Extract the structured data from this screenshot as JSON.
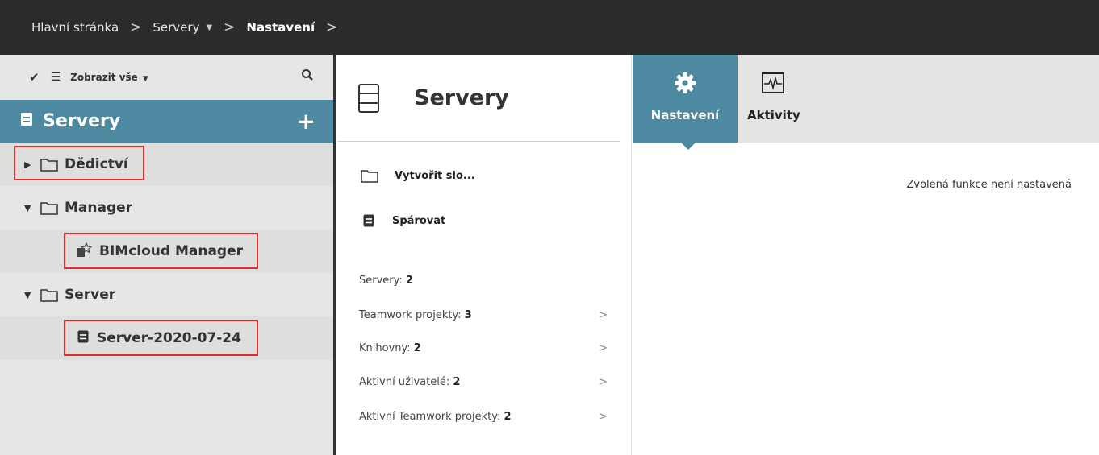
{
  "breadcrumb": {
    "items": [
      "Hlavní stránka",
      "Servery",
      "Nastavení"
    ]
  },
  "left": {
    "toolbar": {
      "filter_label": "Zobrazit vše"
    },
    "header": {
      "title": "Servery"
    },
    "tree": {
      "dedictvi": "Dědictví",
      "manager": "Manager",
      "bimcloud_manager": "BIMcloud Manager",
      "server": "Server",
      "server_item": "Server-2020-07-24"
    }
  },
  "middle": {
    "title": "Servery",
    "actions": [
      "Vytvořit slo...",
      "Spárovat"
    ],
    "stats": [
      {
        "label": "Servery: ",
        "value": "2"
      },
      {
        "label": "Teamwork projekty: ",
        "value": "3"
      },
      {
        "label": "Knihovny: ",
        "value": "2"
      },
      {
        "label": "Aktivní uživatelé: ",
        "value": "2"
      },
      {
        "label": "Aktivní Teamwork projekty: ",
        "value": "2"
      }
    ]
  },
  "right": {
    "tabs": [
      {
        "label": "Nastavení",
        "icon": "gear-icon"
      },
      {
        "label": "Aktivity",
        "icon": "activity-icon"
      }
    ],
    "message": "Zvolená funkce není nastavená"
  },
  "colors": {
    "accent": "#4d8aa1",
    "topbar": "#2b2b2b",
    "highlight_box": "#e32b2b"
  }
}
